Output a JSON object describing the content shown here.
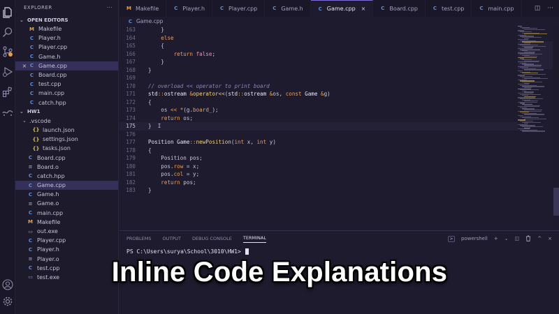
{
  "explorer": {
    "title": "EXPLORER",
    "more": "···",
    "open_editors_title": "OPEN EDITORS",
    "open_editors": [
      {
        "name": "Makefile",
        "icon": "M",
        "type": "makefile"
      },
      {
        "name": "Player.h",
        "icon": "C",
        "type": "cpp-header"
      },
      {
        "name": "Player.cpp",
        "icon": "C",
        "type": "cpp"
      },
      {
        "name": "Game.h",
        "icon": "C",
        "type": "cpp-header"
      },
      {
        "name": "Game.cpp",
        "icon": "C",
        "type": "cpp",
        "selected": true,
        "close": "×"
      },
      {
        "name": "Board.cpp",
        "icon": "C",
        "type": "cpp"
      },
      {
        "name": "test.cpp",
        "icon": "C",
        "type": "cpp"
      },
      {
        "name": "main.cpp",
        "icon": "C",
        "type": "cpp"
      },
      {
        "name": "catch.hpp",
        "icon": "C",
        "type": "cpp"
      }
    ],
    "project_title": "HW1",
    "folder": ".vscode",
    "folder_files": [
      {
        "name": "launch.json",
        "icon": "{}"
      },
      {
        "name": "settings.json",
        "icon": "{}"
      },
      {
        "name": "tasks.json",
        "icon": "{}"
      }
    ],
    "files": [
      {
        "name": "Board.cpp",
        "icon": "C",
        "type": "cpp"
      },
      {
        "name": "Board.o",
        "icon": "≡",
        "type": "object"
      },
      {
        "name": "catch.hpp",
        "icon": "C",
        "type": "cpp"
      },
      {
        "name": "Game.cpp",
        "icon": "C",
        "type": "cpp",
        "selected": true
      },
      {
        "name": "Game.h",
        "icon": "C",
        "type": "cpp-header"
      },
      {
        "name": "Game.o",
        "icon": "≡",
        "type": "object"
      },
      {
        "name": "main.cpp",
        "icon": "C",
        "type": "cpp"
      },
      {
        "name": "Makefile",
        "icon": "M",
        "type": "makefile"
      },
      {
        "name": "out.exe",
        "icon": "▭",
        "type": "exe"
      },
      {
        "name": "Player.cpp",
        "icon": "C",
        "type": "cpp"
      },
      {
        "name": "Player.h",
        "icon": "C",
        "type": "cpp-header"
      },
      {
        "name": "Player.o",
        "icon": "≡",
        "type": "object"
      },
      {
        "name": "test.cpp",
        "icon": "C",
        "type": "cpp"
      },
      {
        "name": "test.exe",
        "icon": "▭",
        "type": "exe"
      }
    ]
  },
  "tabs": [
    {
      "label": "Makefile",
      "icon": "M"
    },
    {
      "label": "Player.h",
      "icon": "C"
    },
    {
      "label": "Player.cpp",
      "icon": "C"
    },
    {
      "label": "Game.h",
      "icon": "C"
    },
    {
      "label": "Game.cpp",
      "icon": "C",
      "active": true,
      "close": "×"
    },
    {
      "label": "Board.cpp",
      "icon": "C"
    },
    {
      "label": "test.cpp",
      "icon": "C"
    },
    {
      "label": "main.cpp",
      "icon": "C"
    }
  ],
  "tab_actions": {
    "split": "◫",
    "more": "···"
  },
  "breadcrumb": {
    "icon": "C",
    "file": "Game.cpp"
  },
  "editor": {
    "current_line": 175,
    "lines": [
      {
        "n": 163,
        "tokens": [
          {
            "t": "    }",
            "c": "pu"
          }
        ]
      },
      {
        "n": 164,
        "tokens": [
          {
            "t": "    ",
            "c": "pu"
          },
          {
            "t": "else",
            "c": "k"
          }
        ]
      },
      {
        "n": 165,
        "tokens": [
          {
            "t": "    {",
            "c": "pu"
          }
        ]
      },
      {
        "n": 166,
        "tokens": [
          {
            "t": "        ",
            "c": "pu"
          },
          {
            "t": "return",
            "c": "k"
          },
          {
            "t": " ",
            "c": "pu"
          },
          {
            "t": "false",
            "c": "kw"
          },
          {
            "t": ";",
            "c": "pu"
          }
        ]
      },
      {
        "n": 167,
        "tokens": [
          {
            "t": "    }",
            "c": "pu"
          }
        ]
      },
      {
        "n": 168,
        "tokens": [
          {
            "t": "}",
            "c": "pu"
          }
        ]
      },
      {
        "n": 169,
        "tokens": []
      },
      {
        "n": 170,
        "tokens": [
          {
            "t": "// overload << operator to print board",
            "c": "cm"
          }
        ]
      },
      {
        "n": 171,
        "tokens": [
          {
            "t": "std",
            "c": "ty"
          },
          {
            "t": "::",
            "c": "op"
          },
          {
            "t": "ostream",
            "c": "ty"
          },
          {
            "t": " &",
            "c": "op"
          },
          {
            "t": "operator<<",
            "c": "fn"
          },
          {
            "t": "(",
            "c": "pu"
          },
          {
            "t": "std",
            "c": "ty"
          },
          {
            "t": "::",
            "c": "op"
          },
          {
            "t": "ostream",
            "c": "ty"
          },
          {
            "t": " &",
            "c": "op"
          },
          {
            "t": "os",
            "c": "pu"
          },
          {
            "t": ", ",
            "c": "pu"
          },
          {
            "t": "const",
            "c": "k"
          },
          {
            "t": " Game ",
            "c": "ty"
          },
          {
            "t": "&",
            "c": "op"
          },
          {
            "t": "g",
            "c": "pu"
          },
          {
            "t": ")",
            "c": "pu"
          }
        ]
      },
      {
        "n": 172,
        "tokens": [
          {
            "t": "{",
            "c": "pu"
          }
        ]
      },
      {
        "n": 173,
        "tokens": [
          {
            "t": "    os ",
            "c": "pu"
          },
          {
            "t": "<<",
            "c": "op"
          },
          {
            "t": " ",
            "c": "pu"
          },
          {
            "t": "*",
            "c": "op"
          },
          {
            "t": "(g.",
            "c": "pu"
          },
          {
            "t": "board_",
            "c": "vr"
          },
          {
            "t": ");",
            "c": "pu"
          }
        ]
      },
      {
        "n": 174,
        "tokens": [
          {
            "t": "    ",
            "c": "pu"
          },
          {
            "t": "return",
            "c": "k"
          },
          {
            "t": " os;",
            "c": "pu"
          }
        ]
      },
      {
        "n": 175,
        "tokens": [
          {
            "t": "}",
            "c": "pu"
          },
          {
            "t": "  I",
            "c": "pu"
          }
        ]
      },
      {
        "n": 176,
        "tokens": []
      },
      {
        "n": 177,
        "tokens": [
          {
            "t": "Position Game",
            "c": "ty"
          },
          {
            "t": "::",
            "c": "op"
          },
          {
            "t": "newPosition",
            "c": "fn"
          },
          {
            "t": "(",
            "c": "pu"
          },
          {
            "t": "int",
            "c": "k"
          },
          {
            "t": " x, ",
            "c": "pu"
          },
          {
            "t": "int",
            "c": "k"
          },
          {
            "t": " y)",
            "c": "pu"
          }
        ]
      },
      {
        "n": 178,
        "tokens": [
          {
            "t": "{",
            "c": "pu"
          }
        ]
      },
      {
        "n": 179,
        "tokens": [
          {
            "t": "    Position pos;",
            "c": "pu"
          }
        ]
      },
      {
        "n": 180,
        "tokens": [
          {
            "t": "    pos.",
            "c": "pu"
          },
          {
            "t": "row",
            "c": "vr"
          },
          {
            "t": " = x;",
            "c": "pu"
          }
        ]
      },
      {
        "n": 181,
        "tokens": [
          {
            "t": "    pos.",
            "c": "pu"
          },
          {
            "t": "col",
            "c": "vr"
          },
          {
            "t": " = y;",
            "c": "pu"
          }
        ]
      },
      {
        "n": 182,
        "tokens": [
          {
            "t": "    ",
            "c": "pu"
          },
          {
            "t": "return",
            "c": "k"
          },
          {
            "t": " pos;",
            "c": "pu"
          }
        ]
      },
      {
        "n": 183,
        "tokens": [
          {
            "t": "}",
            "c": "pu"
          }
        ]
      }
    ]
  },
  "panel": {
    "tabs": [
      {
        "label": "PROBLEMS"
      },
      {
        "label": "OUTPUT"
      },
      {
        "label": "DEBUG CONSOLE"
      },
      {
        "label": "TERMINAL",
        "active": true
      }
    ],
    "shell_icon": ">",
    "shell_name": "powershell",
    "actions": {
      "add": "+",
      "dropdown": "⌄",
      "split": "◫",
      "kill": "🗑",
      "maximize": "^",
      "close": "×"
    },
    "prompt": "PS C:\\Users\\surya\\School\\3010\\HW1> "
  },
  "overlay": {
    "title": "Inline Code Explanations"
  },
  "colors": {
    "accent": "#7a6fd0",
    "background": "#1e1b2e",
    "keyword": "#f09c5a",
    "function": "#f6d36b",
    "comment": "#8a87b8"
  }
}
